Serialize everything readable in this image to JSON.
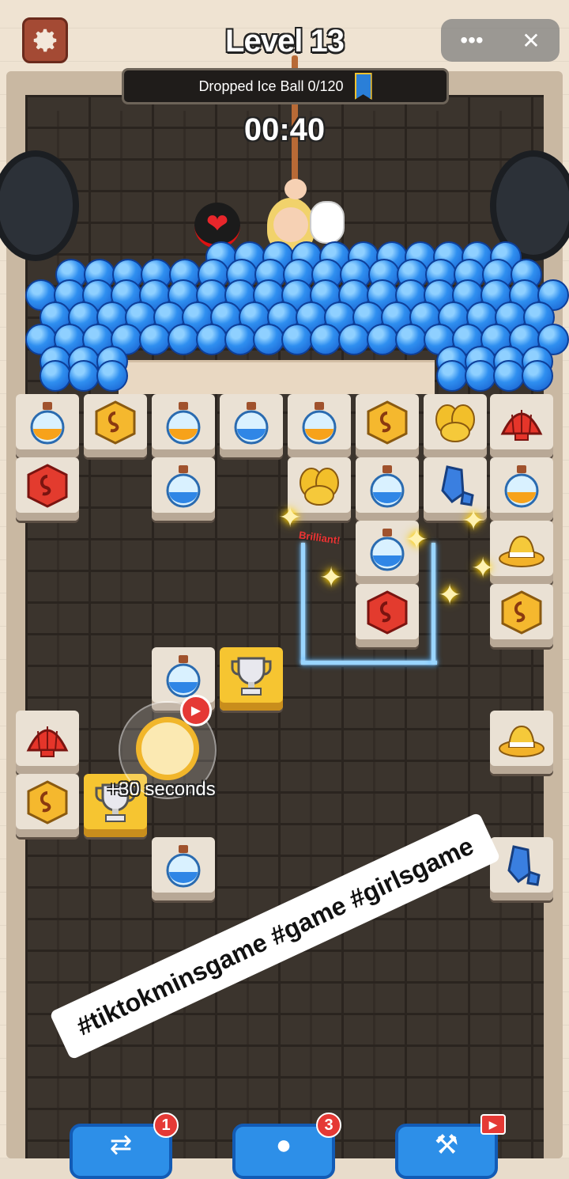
{
  "header": {
    "level_title": "Level 13",
    "goal_text": "Dropped Ice Ball 0/120",
    "timer": "00:40",
    "menu_label": "•••",
    "close_label": "✕"
  },
  "board": {
    "brilliant_text": "Brilliant!",
    "bonus_text": "+30 seconds",
    "video_icon": "▶"
  },
  "caption": "#tiktokminsgame #game #girlsgame",
  "toolbar": {
    "shuffle_count": "1",
    "hint_count": "3",
    "shuffle_icon": "⇄",
    "hint_icon": "●",
    "hammer_icon": "⚒",
    "film_icon": "▶"
  },
  "colors": {
    "accent_blue": "#2d8fe8",
    "badge_red": "#e53935",
    "ice_ball": "#2f8ff0"
  },
  "tile_icons": [
    "potion-orange",
    "gem-gold",
    "potion-blue",
    "leaf-gold",
    "shell-red",
    "gem-red",
    "crystal-blue",
    "hat-gold",
    "trophy-silver"
  ]
}
